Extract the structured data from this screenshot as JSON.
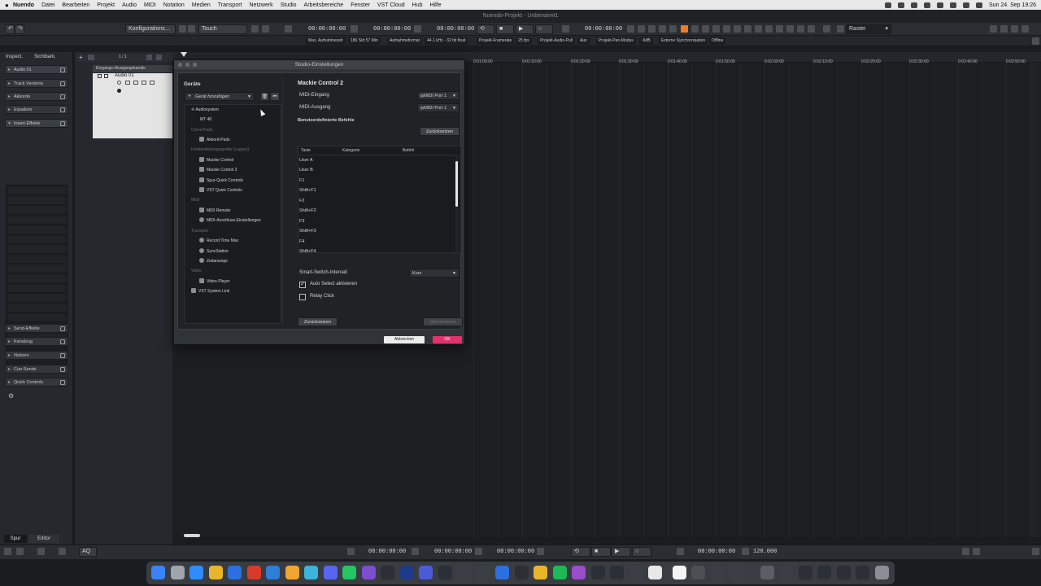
{
  "menubar": {
    "items": [
      "Nuendo",
      "Datei",
      "Bearbeiten",
      "Projekt",
      "Audio",
      "MIDI",
      "Notation",
      "Medien",
      "Transport",
      "Netzwerk",
      "Studio",
      "Arbeitsbereiche",
      "Fenster",
      "VST Cloud",
      "Hub",
      "Hilfe"
    ],
    "clock": "Sun 24. Sep 19:26"
  },
  "window": {
    "title": "Nuendo-Projekt - Unbenannt1"
  },
  "toolbar": {
    "config_label": "Konfigurations…",
    "touch_label": "Touch",
    "time1": "00:00:00:00",
    "time2": "00:00:00:00",
    "time3": "00:00:00:00",
    "time4": "00:00:00:00",
    "raster_label": "Raster"
  },
  "infoline": [
    "Max. Aufnahmezeit",
    "186 Std 57 Min",
    "Aufnahmeformat",
    "44.1 kHz - 32 bit float",
    "Projekt-Framerate",
    "25 fps",
    "Projekt-Audio-Pull",
    "Aus",
    "Projekt-Pan-Modus",
    "-6dB",
    "Externe Synchronisation",
    "Offline"
  ],
  "inspector": {
    "tab_inspector": "Inspect.",
    "tab_visibility": "Sichtbark.",
    "track_name": "Audio 01",
    "sections_top": [
      "Track Versions",
      "Akkorde",
      "Equalizer",
      "Insert-Effekte"
    ],
    "sections_bottom": [
      "Send-Effekte",
      "Kanalzug",
      "Notizen",
      "Cue-Sends",
      "Quick Controls"
    ],
    "bottom_tab_spur": "Spur",
    "bottom_tab_editor": "Editor"
  },
  "tracklist": {
    "count": "1 / 1",
    "folder_name": "Eingangs-/Ausgangskanäle",
    "track_name": "Audio 01"
  },
  "ruler": [
    "0:01:00:00",
    "0:01:10:00",
    "0:01:20:00",
    "0:01:30:00",
    "0:01:40:00",
    "0:01:50:00",
    "0:02:00:00",
    "0:02:10:00",
    "0:02:20:00",
    "0:02:30:00",
    "0:02:40:00",
    "0:02:50:00"
  ],
  "transport": {
    "time_left": "00:00:00:00",
    "time_mid": "00:00:00:00",
    "time_right": "00:00:00:00",
    "time_far": "00:00:00:00",
    "tempo": "120.000",
    "aq_label": "AQ"
  },
  "dialog": {
    "title": "Studio-Einstellungen",
    "devices_title": "Geräte",
    "add_device": "Gerät hinzufügen",
    "tree": [
      {
        "label": "Audiosystem",
        "type": "item",
        "icon": "audio-system"
      },
      {
        "label": "MT 48",
        "type": "sub"
      },
      {
        "label": "Chord Pads",
        "type": "cat"
      },
      {
        "label": "Akkord-Pads",
        "type": "item",
        "icon": "chord-pads"
      },
      {
        "label": "Fernbedienungsgeräte (Legacy)",
        "type": "cat"
      },
      {
        "label": "Mackie Control",
        "type": "item",
        "icon": "mackie"
      },
      {
        "label": "Mackie Control 2",
        "type": "selected",
        "icon": "mackie"
      },
      {
        "label": "Spur-Quick Controls",
        "type": "item",
        "icon": "mackie"
      },
      {
        "label": "VST Quick Controls",
        "type": "item",
        "icon": "mackie"
      },
      {
        "label": "MIDI",
        "type": "cat"
      },
      {
        "label": "MIDI Remote",
        "type": "item",
        "icon": "midi-remote"
      },
      {
        "label": "MIDI-Anschluss-Einstellungen",
        "type": "item",
        "icon": "midi-port"
      },
      {
        "label": "Transport",
        "type": "cat"
      },
      {
        "label": "Record Time Max",
        "type": "item",
        "icon": "record-time"
      },
      {
        "label": "SyncStation",
        "type": "item",
        "icon": "sync"
      },
      {
        "label": "Zeitanzeige",
        "type": "item",
        "icon": "time-display"
      },
      {
        "label": "Video",
        "type": "cat"
      },
      {
        "label": "Video-Player",
        "type": "item",
        "icon": "video"
      },
      {
        "label": "VST System Link",
        "type": "item",
        "icon": "system-link"
      }
    ],
    "device_title": "Mackie Control 2",
    "midi_in_label": "MIDI-Eingang",
    "midi_in_value": "ipMIDI Port 1",
    "midi_out_label": "MIDI-Ausgang",
    "midi_out_value": "ipMIDI Port 1",
    "user_commands_title": "Benutzerdefinierte Befehle",
    "reset_top": "Zurücksetzen",
    "table_headers": [
      "Taste",
      "Kategorie",
      "Befehl"
    ],
    "table_rows": [
      "User A",
      "User B",
      "F1",
      "Shift+F1",
      "F2",
      "Shift+F2",
      "F3",
      "Shift+F3",
      "F4",
      "Shift+F4"
    ],
    "smart_switch_label": "Smart-Switch-Intervall",
    "smart_switch_value": "Kurz",
    "auto_select_label": "Auto Select aktivieren",
    "auto_select_checked": true,
    "relay_click_label": "Relay Click",
    "relay_click_checked": false,
    "reset_bottom": "Zurücksetzen",
    "apply": "Übernehmen",
    "cancel": "Abbrechen",
    "ok": "OK"
  },
  "colors": {
    "ok_button": "#e0336e",
    "record_accent": "#e8802a",
    "meter_green": "#35c45a"
  }
}
